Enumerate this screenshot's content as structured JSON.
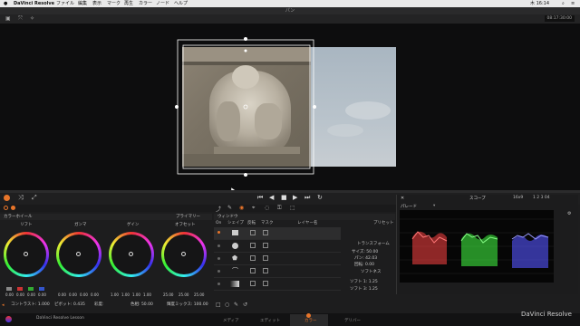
{
  "menubar": {
    "app_name": "DaVinci Resolve",
    "menus": [
      "ファイル",
      "編集",
      "表示",
      "マーク",
      "再生",
      "カラー",
      "ノード",
      "ヘルプ"
    ],
    "clock": "木 16:14"
  },
  "window": {
    "title": "パン",
    "timecode": "08:17:30:00"
  },
  "color_wheels": {
    "panel_title": "カラーホイール",
    "wheels": [
      {
        "label": "リフト",
        "values": [
          "0.00",
          "0.00",
          "0.00",
          "0.00"
        ]
      },
      {
        "label": "ガンマ",
        "values": [
          "0.00",
          "0.00",
          "0.00",
          "0.00"
        ]
      },
      {
        "label": "ゲイン",
        "values": [
          "1.00",
          "1.00",
          "1.00",
          "1.00"
        ]
      },
      {
        "label": "オフセット",
        "values": [
          "25.00",
          "25.00",
          "25.00"
        ]
      }
    ],
    "primary_label": "プライマリー",
    "footer": {
      "contrast": "コントラスト: 1.000",
      "pivot": "ピボット: 0.435",
      "sat_label": "彩度:",
      "hue": "色相: 50.00",
      "lum_mix": "輝度ミックス: 100.00"
    }
  },
  "window_panel": {
    "title": "ウィンドウ",
    "columns": [
      "On",
      "シェイプ",
      "反転",
      "マスク",
      "レイヤー名"
    ],
    "preset_label": "プリセット",
    "transform_label": "トランスフォーム",
    "size": "サイズ: 50.00",
    "pan": "パン: 42.03",
    "rotate": "回転: 0.00",
    "softness_label": "ソフトネス",
    "soft1": "ソフト 1: 1.25",
    "soft3": "ソフト 3: 1.25"
  },
  "scope": {
    "title": "スコープ",
    "mode": "パレード",
    "aspect": "16x9",
    "pager": "1 2 3 04"
  },
  "pages": {
    "media": "メディア",
    "edit": "エディット",
    "color": "カラー",
    "deliver": "デリバー"
  },
  "lesson": "DaVinci Resolve Lesson",
  "watermark": "DaVinci Resolve",
  "colors": {
    "accent": "#e8752a",
    "scope_red": "#ff4444",
    "scope_green": "#44ff44",
    "scope_blue": "#5555ff"
  }
}
